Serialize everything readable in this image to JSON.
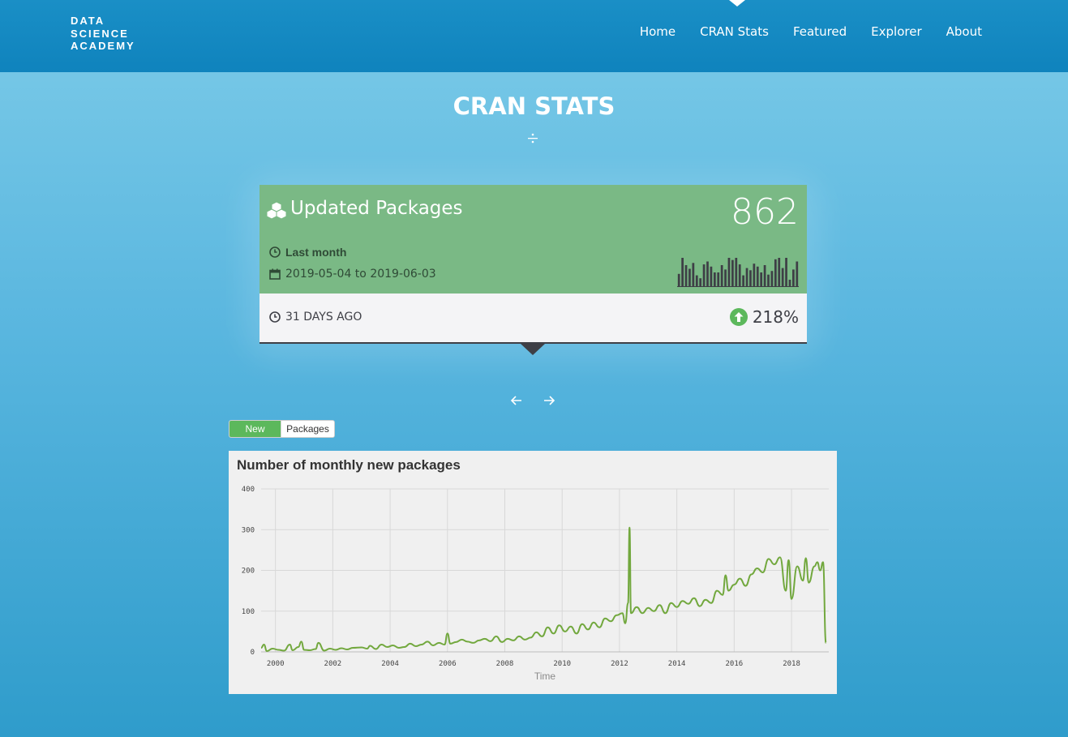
{
  "header": {
    "brand": [
      "DATA",
      "SCIENCE",
      "ACADEMY"
    ],
    "nav": [
      "Home",
      "CRAN Stats",
      "Featured",
      "Explorer",
      "About"
    ],
    "active_nav": "CRAN Stats"
  },
  "page": {
    "title": "CRAN STATS"
  },
  "card": {
    "title": "Updated Packages",
    "value": "862",
    "period": "Last month",
    "range": "2019-05-04 to 2019-06-03",
    "ago": "31 DAYS AGO",
    "change": "218%",
    "sparkline": [
      18,
      40,
      30,
      25,
      33,
      16,
      12,
      31,
      35,
      28,
      20,
      20,
      30,
      24,
      40,
      37,
      40,
      31,
      16,
      26,
      23,
      32,
      28,
      20,
      30,
      17,
      22,
      38,
      40,
      26,
      40,
      10,
      24,
      35
    ]
  },
  "toggle": {
    "on_label": "New",
    "off_label": "Packages"
  },
  "chart_data": {
    "type": "line",
    "title": "Number of monthly new packages",
    "xlabel": "Time",
    "ylabel": "",
    "xlim": [
      1999.5,
      2019.3
    ],
    "ylim": [
      0,
      400
    ],
    "x_ticks": [
      "2000",
      "2002",
      "2004",
      "2006",
      "2008",
      "2010",
      "2012",
      "2014",
      "2016",
      "2018"
    ],
    "y_ticks": [
      "0",
      "100",
      "200",
      "300",
      "400"
    ],
    "color": "#72a83e",
    "series": [
      {
        "points": [
          [
            1999.5,
            10
          ],
          [
            1999.6,
            18
          ],
          [
            1999.7,
            2
          ],
          [
            1999.9,
            8
          ],
          [
            2000.1,
            5
          ],
          [
            2000.3,
            3
          ],
          [
            2000.5,
            18
          ],
          [
            2000.6,
            4
          ],
          [
            2000.8,
            12
          ],
          [
            2000.9,
            25
          ],
          [
            2001.0,
            5
          ],
          [
            2001.2,
            4
          ],
          [
            2001.4,
            7
          ],
          [
            2001.5,
            22
          ],
          [
            2001.7,
            3
          ],
          [
            2001.9,
            8
          ],
          [
            2002.1,
            5
          ],
          [
            2002.3,
            9
          ],
          [
            2002.5,
            6
          ],
          [
            2002.7,
            10
          ],
          [
            2003.0,
            11
          ],
          [
            2003.2,
            8
          ],
          [
            2003.3,
            15
          ],
          [
            2003.5,
            7
          ],
          [
            2003.7,
            18
          ],
          [
            2003.9,
            12
          ],
          [
            2004.1,
            16
          ],
          [
            2004.3,
            10
          ],
          [
            2004.5,
            12
          ],
          [
            2004.7,
            20
          ],
          [
            2004.9,
            14
          ],
          [
            2005.1,
            18
          ],
          [
            2005.3,
            25
          ],
          [
            2005.5,
            16
          ],
          [
            2005.7,
            22
          ],
          [
            2005.9,
            18
          ],
          [
            2006.0,
            45
          ],
          [
            2006.1,
            20
          ],
          [
            2006.3,
            24
          ],
          [
            2006.5,
            30
          ],
          [
            2006.7,
            25
          ],
          [
            2006.9,
            22
          ],
          [
            2007.1,
            28
          ],
          [
            2007.3,
            32
          ],
          [
            2007.5,
            26
          ],
          [
            2007.7,
            38
          ],
          [
            2007.9,
            24
          ],
          [
            2008.1,
            32
          ],
          [
            2008.3,
            28
          ],
          [
            2008.5,
            38
          ],
          [
            2008.7,
            30
          ],
          [
            2008.9,
            35
          ],
          [
            2009.1,
            48
          ],
          [
            2009.3,
            38
          ],
          [
            2009.5,
            60
          ],
          [
            2009.7,
            45
          ],
          [
            2009.9,
            65
          ],
          [
            2010.1,
            50
          ],
          [
            2010.3,
            62
          ],
          [
            2010.5,
            45
          ],
          [
            2010.7,
            68
          ],
          [
            2010.9,
            55
          ],
          [
            2011.1,
            72
          ],
          [
            2011.3,
            60
          ],
          [
            2011.5,
            82
          ],
          [
            2011.7,
            75
          ],
          [
            2011.9,
            90
          ],
          [
            2012.1,
            95
          ],
          [
            2012.2,
            70
          ],
          [
            2012.3,
            120
          ],
          [
            2012.35,
            305
          ],
          [
            2012.4,
            95
          ],
          [
            2012.6,
            110
          ],
          [
            2012.8,
            95
          ],
          [
            2013.0,
            108
          ],
          [
            2013.2,
            100
          ],
          [
            2013.4,
            115
          ],
          [
            2013.6,
            95
          ],
          [
            2013.8,
            120
          ],
          [
            2014.0,
            110
          ],
          [
            2014.2,
            125
          ],
          [
            2014.4,
            118
          ],
          [
            2014.6,
            132
          ],
          [
            2014.8,
            112
          ],
          [
            2015.0,
            128
          ],
          [
            2015.2,
            120
          ],
          [
            2015.4,
            150
          ],
          [
            2015.6,
            140
          ],
          [
            2015.7,
            188
          ],
          [
            2015.8,
            150
          ],
          [
            2016.0,
            165
          ],
          [
            2016.2,
            180
          ],
          [
            2016.4,
            162
          ],
          [
            2016.6,
            190
          ],
          [
            2016.8,
            205
          ],
          [
            2017.0,
            195
          ],
          [
            2017.2,
            228
          ],
          [
            2017.4,
            215
          ],
          [
            2017.6,
            232
          ],
          [
            2017.8,
            150
          ],
          [
            2017.9,
            225
          ],
          [
            2018.0,
            130
          ],
          [
            2018.2,
            210
          ],
          [
            2018.4,
            175
          ],
          [
            2018.5,
            230
          ],
          [
            2018.6,
            170
          ],
          [
            2018.8,
            210
          ],
          [
            2018.9,
            220
          ],
          [
            2019.0,
            200
          ],
          [
            2019.1,
            220
          ],
          [
            2019.2,
            22
          ]
        ]
      }
    ]
  }
}
